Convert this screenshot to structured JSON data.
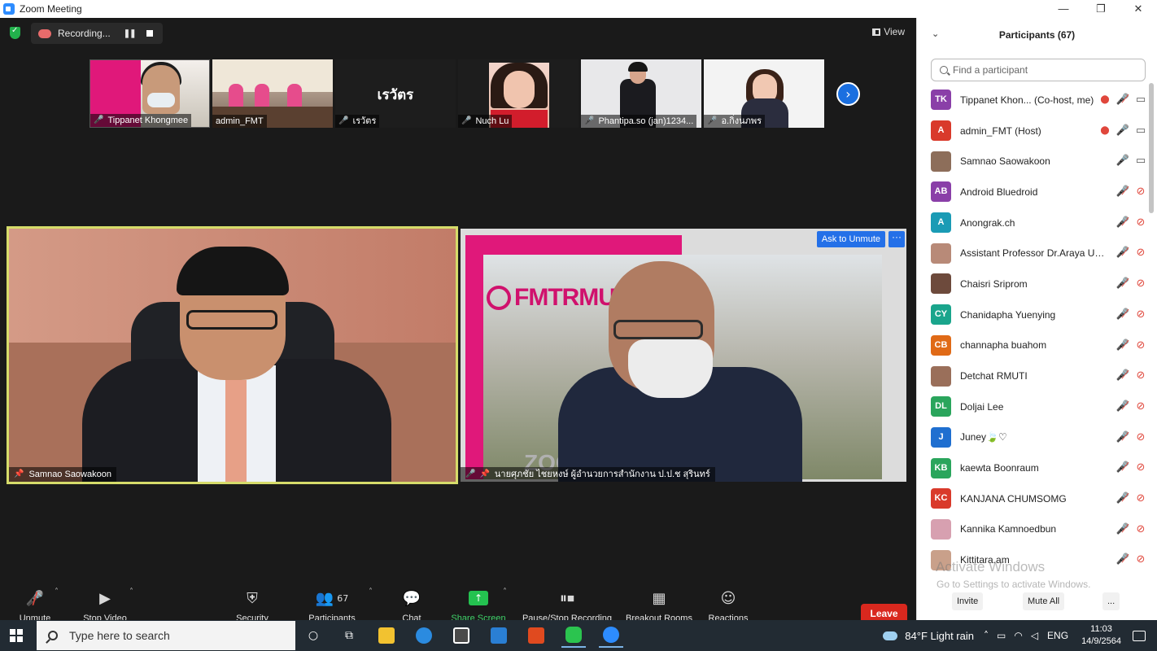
{
  "window": {
    "title": "Zoom Meeting",
    "controls": [
      "—",
      "❐",
      "✕"
    ]
  },
  "topbar": {
    "recording_label": "Recording...",
    "view_label": "View"
  },
  "thumbnails": [
    {
      "name": "Tippanet Khongmee"
    },
    {
      "name": "admin_FMT"
    },
    {
      "name": "เรวัตร",
      "big_name": "เรวัตร"
    },
    {
      "name": "Nuch Lu"
    },
    {
      "name": "Phantipa.so (jan)1234..."
    },
    {
      "name": "อ.กิ่งนภพร"
    }
  ],
  "videos": {
    "left": {
      "name": "Samnao Saowakoon"
    },
    "right": {
      "name": "นายศุภชัย ไชยหงษ์ ผู้อำนวยการสำนักงาน ป.ป.ช สุรินทร์",
      "ask_unmute": "Ask to Unmute",
      "more": "···",
      "banner": "FMTRMUTI",
      "zoom_text": "ZOO"
    }
  },
  "toolbar": {
    "unmute": "Unmute",
    "stop_video": "Stop Video",
    "security": "Security",
    "participants": "Participants",
    "participant_count": "67",
    "chat": "Chat",
    "share_screen": "Share Screen",
    "pause_stop_recording": "Pause/Stop Recording",
    "breakout_rooms": "Breakout Rooms",
    "reactions": "Reactions",
    "leave": "Leave"
  },
  "panel": {
    "title": "Participants (67)",
    "search_placeholder": "Find a participant",
    "participants": [
      {
        "initials": "TK",
        "name": "Tippanet Khon... (Co-host, me)",
        "color": "#8a3fa8",
        "rec": true,
        "mic": "muted",
        "video": "on"
      },
      {
        "initials": "A",
        "name": "admin_FMT (Host)",
        "color": "#d93a2b",
        "rec": true,
        "mic": "on",
        "video": "on"
      },
      {
        "initials": "",
        "name": "Samnao Saowakoon",
        "color": "#8d6e5a",
        "rec": false,
        "mic": "on",
        "video": "on"
      },
      {
        "initials": "AB",
        "name": "Android Bluedroid",
        "color": "#8a3fa8",
        "rec": false,
        "mic": "muted",
        "video": "off"
      },
      {
        "initials": "A",
        "name": "Anongrak.ch",
        "color": "#1a9bb5",
        "rec": false,
        "mic": "muted",
        "video": "off"
      },
      {
        "initials": "",
        "name": "Assistant Professor Dr.Araya Uen...",
        "color": "#b88a78",
        "rec": false,
        "mic": "muted",
        "video": "off"
      },
      {
        "initials": "",
        "name": "Chaisri Sriprom",
        "color": "#6d4a3c",
        "rec": false,
        "mic": "muted",
        "video": "off"
      },
      {
        "initials": "CY",
        "name": "Chanidapha Yuenying",
        "color": "#1aa58c",
        "rec": false,
        "mic": "muted",
        "video": "off"
      },
      {
        "initials": "CB",
        "name": "channapha buahom",
        "color": "#e06a17",
        "rec": false,
        "mic": "muted",
        "video": "off"
      },
      {
        "initials": "",
        "name": "Detchat RMUTI",
        "color": "#9a6f5a",
        "rec": false,
        "mic": "muted",
        "video": "off"
      },
      {
        "initials": "DL",
        "name": "Doljai Lee",
        "color": "#2aa55c",
        "rec": false,
        "mic": "muted",
        "video": "off"
      },
      {
        "initials": "J",
        "name": "Juney🍃♡",
        "color": "#1f6fd0",
        "rec": false,
        "mic": "muted",
        "video": "off"
      },
      {
        "initials": "KB",
        "name": "kaewta Boonraum",
        "color": "#2aa55c",
        "rec": false,
        "mic": "muted",
        "video": "off"
      },
      {
        "initials": "KC",
        "name": "KANJANA CHUMSOMG",
        "color": "#d93a2b",
        "rec": false,
        "mic": "muted",
        "video": "off"
      },
      {
        "initials": "",
        "name": "Kannika Kamnoedbun",
        "color": "#d7a0b0",
        "rec": false,
        "mic": "muted",
        "video": "off"
      },
      {
        "initials": "",
        "name": "Kittitara.am",
        "color": "#c9a08a",
        "rec": false,
        "mic": "muted",
        "video": "off"
      }
    ],
    "invite": "Invite",
    "mute_all": "Mute All",
    "more": "...",
    "watermark_title": "Activate Windows",
    "watermark_sub": "Go to Settings to activate Windows."
  },
  "taskbar": {
    "search_placeholder": "Type here to search",
    "weather": "84°F  Light rain",
    "language": "ENG",
    "time": "11:03",
    "date": "14/9/2564"
  }
}
